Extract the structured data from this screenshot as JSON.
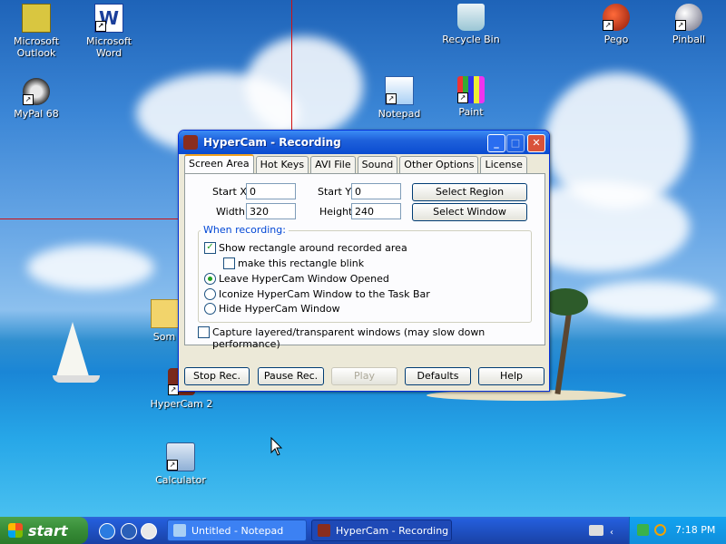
{
  "desktop": {
    "icons": [
      {
        "label": "Microsoft Outlook",
        "icon": "outlook-icon"
      },
      {
        "label": "Microsoft Word",
        "icon": "word-icon"
      },
      {
        "label": "Recycle Bin",
        "icon": "recycle-bin-icon"
      },
      {
        "label": "Pego",
        "icon": "pego-icon"
      },
      {
        "label": "Pinball",
        "icon": "pinball-icon"
      },
      {
        "label": "MyPal 68",
        "icon": "mypal-icon"
      },
      {
        "label": "Notepad",
        "icon": "notepad-icon"
      },
      {
        "label": "Paint",
        "icon": "paint-icon"
      },
      {
        "label": "Som",
        "icon": "folder-icon"
      },
      {
        "label": "HyperCam 2",
        "icon": "hypercam-icon"
      },
      {
        "label": "Calculator",
        "icon": "calculator-icon"
      }
    ]
  },
  "window": {
    "title": "HyperCam - Recording",
    "tabs": [
      "Screen Area",
      "Hot Keys",
      "AVI File",
      "Sound",
      "Other Options",
      "License"
    ],
    "screen_area": {
      "start_x_label": "Start X",
      "start_x_value": "0",
      "start_y_label": "Start Y",
      "start_y_value": "0",
      "width_label": "Width",
      "width_value": "320",
      "height_label": "Height",
      "height_value": "240",
      "select_region": "Select Region",
      "select_window": "Select Window",
      "group_title": "When recording:",
      "show_rect": "Show rectangle around recorded area",
      "blink_rect": "make this rectangle blink",
      "leave_opened": "Leave HyperCam Window Opened",
      "iconize": "Iconize HyperCam Window to the Task Bar",
      "hide": "Hide HyperCam Window",
      "capture_layered": "Capture layered/transparent windows (may slow down performance)"
    },
    "buttons": {
      "stop": "Stop Rec.",
      "pause": "Pause Rec.",
      "play": "Play",
      "defaults": "Defaults",
      "help": "Help"
    }
  },
  "taskbar": {
    "start": "start",
    "tasks": [
      "Untitled - Notepad",
      "HyperCam - Recording"
    ],
    "clock": "7:18 PM"
  }
}
